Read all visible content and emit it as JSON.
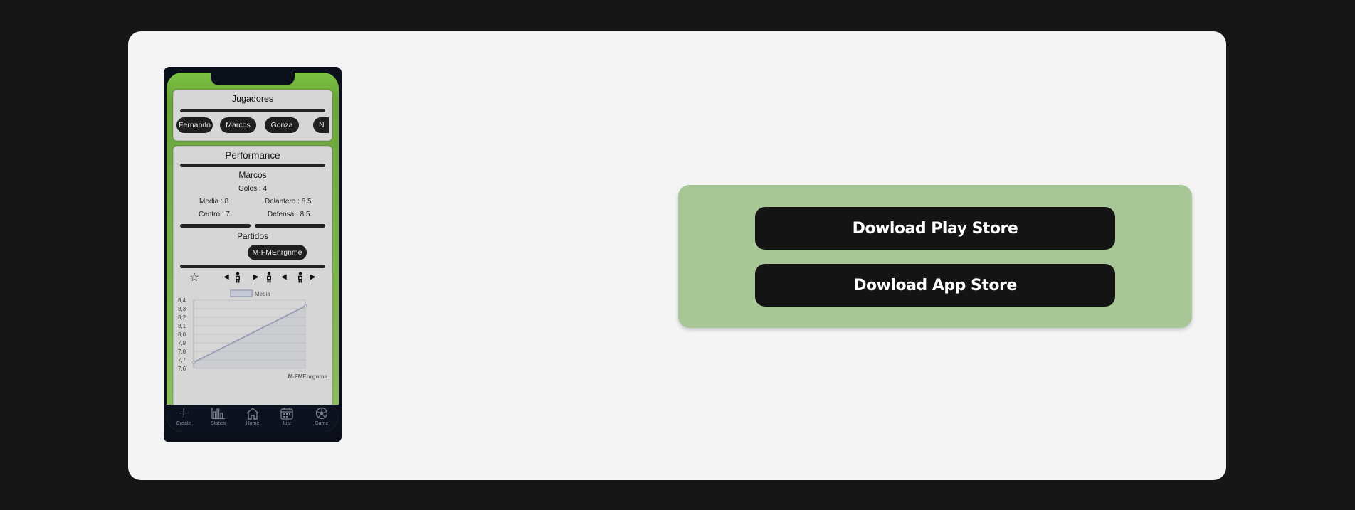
{
  "phone": {
    "players_panel": {
      "title": "Jugadores",
      "chips": [
        "Fernando",
        "Marcos",
        "Gonza",
        "N"
      ]
    },
    "performance_panel": {
      "title": "Performance",
      "player_name": "Marcos",
      "goals": "Goles : 4",
      "stats": {
        "media": "Media : 8",
        "delantero": "Delantero : 8.5",
        "centro": "Centro : 7",
        "defensa": "Defensa : 8.5"
      },
      "matches_title": "Partidos",
      "match_chip": "M-FMEnrgnme"
    },
    "chart_data": {
      "type": "line",
      "series": [
        {
          "name": "Media",
          "x": [
            "",
            "M-FMEnrgnme"
          ],
          "values": [
            7.67,
            8.33
          ]
        }
      ],
      "yticks": [
        "8,4",
        "8,3",
        "8,2",
        "8,1",
        "8,0",
        "7,9",
        "7,8",
        "7,7",
        "7,6"
      ],
      "ylim": [
        7.6,
        8.4
      ],
      "xlabel_right": "M-FMEnrgnme",
      "grid": true,
      "legend": "top",
      "line_color": "#9aa0b4"
    },
    "tabbar": [
      {
        "label": "Create",
        "icon": "plus-icon"
      },
      {
        "label": "Statics",
        "icon": "bar-chart-icon"
      },
      {
        "label": "Home",
        "icon": "home-icon"
      },
      {
        "label": "List",
        "icon": "calendar-icon"
      },
      {
        "label": "Game",
        "icon": "soccer-ball-icon"
      }
    ]
  },
  "download": {
    "play_store": "Dowload Play Store",
    "app_store": "Dowload App Store"
  },
  "colors": {
    "background": "#161616",
    "card": "#f4f4f4",
    "download_box": "#a8c796",
    "button": "#141414"
  }
}
